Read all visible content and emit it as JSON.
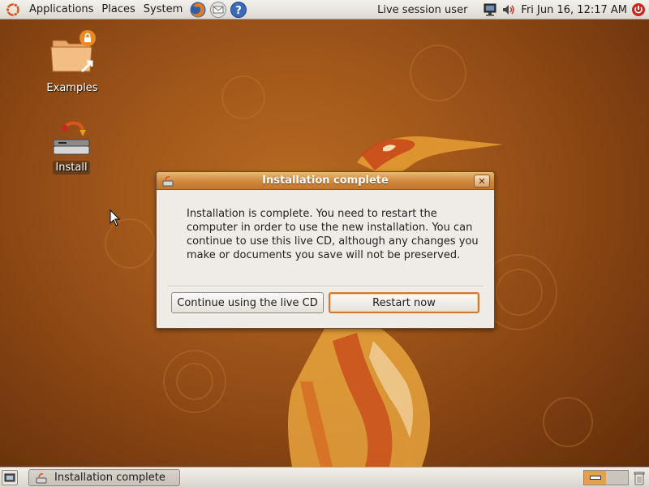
{
  "top_panel": {
    "menus": [
      "Applications",
      "Places",
      "System"
    ],
    "launchers": [
      "firefox-icon",
      "mail-icon",
      "help-icon"
    ],
    "user": "Live session user",
    "clock": "Fri Jun 16, 12:17 AM",
    "tray_icons": [
      "network-icon",
      "volume-icon",
      "power-icon"
    ]
  },
  "desktop": {
    "icons": [
      {
        "label": "Examples",
        "icon": "folder-icon"
      },
      {
        "label": "Install",
        "icon": "install-icon"
      }
    ]
  },
  "dialog": {
    "title": "Installation complete",
    "message": "Installation is complete. You need to restart the computer in order to use the new installation. You can continue to use this live CD, although any changes you make or documents you save will not be preserved.",
    "continue_label": "Continue using the live CD",
    "restart_label": "Restart now"
  },
  "bottom_panel": {
    "task_label": "Installation complete"
  },
  "colors": {
    "accent": "#d07a30",
    "titlebar": "#d0883c",
    "desktop": "#a0561a"
  }
}
